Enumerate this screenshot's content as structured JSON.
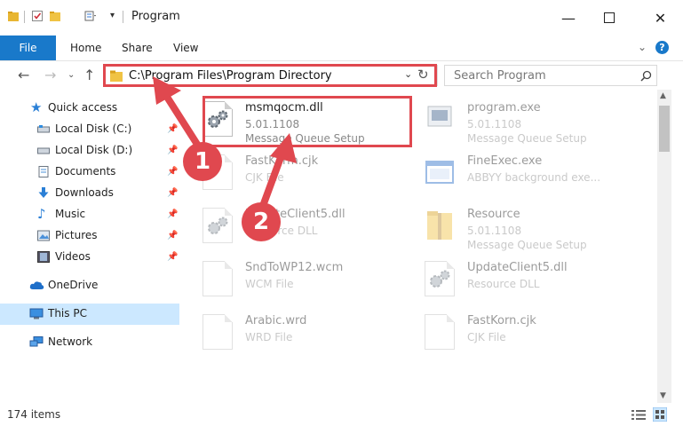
{
  "window": {
    "title": "Program"
  },
  "ribbon": {
    "tabs": [
      "File",
      "Home",
      "Share",
      "View"
    ]
  },
  "address": {
    "path": "C:\\Program Files\\Program Directory"
  },
  "search": {
    "placeholder": "Search Program"
  },
  "nav": {
    "quick_access": "Quick access",
    "items": [
      {
        "label": "Local Disk (C:)",
        "icon": "drive-icon"
      },
      {
        "label": "Local Disk (D:)",
        "icon": "drive-icon"
      },
      {
        "label": "Documents",
        "icon": "documents-icon"
      },
      {
        "label": "Downloads",
        "icon": "downloads-icon"
      },
      {
        "label": "Music",
        "icon": "music-icon"
      },
      {
        "label": "Pictures",
        "icon": "pictures-icon"
      },
      {
        "label": "Videos",
        "icon": "videos-icon"
      }
    ],
    "onedrive": "OneDrive",
    "this_pc": "This PC",
    "network": "Network"
  },
  "files": [
    {
      "name": "msmqocm.dll",
      "line2": "5.01.1108",
      "line3": "Message Queue Setup",
      "icon": "dll-gear-icon"
    },
    {
      "name": "program.exe",
      "line2": "5.01.1108",
      "line3": "Message Queue Setup",
      "icon": "exe-icon"
    },
    {
      "name": "FastKorm.cjk",
      "line2": "CJK File",
      "line3": "",
      "icon": "file-icon"
    },
    {
      "name": "FineExec.exe",
      "line2": "ABBYY background exe...",
      "line3": "",
      "icon": "window-exe-icon"
    },
    {
      "name": "UpdateClient5.dll",
      "line2": "Resource DLL",
      "line3": "",
      "icon": "dll-gear-icon"
    },
    {
      "name": "Resource",
      "line2": "5.01.1108",
      "line3": "Message Queue Setup",
      "icon": "folder-zip-icon"
    },
    {
      "name": "SndToWP12.wcm",
      "line2": "WCM File",
      "line3": "",
      "icon": "file-icon"
    },
    {
      "name": "UpdateClient5.dll",
      "line2": "Resource DLL",
      "line3": "",
      "icon": "dll-gear-icon"
    },
    {
      "name": "Arabic.wrd",
      "line2": "WRD File",
      "line3": "",
      "icon": "file-icon"
    },
    {
      "name": "FastKorn.cjk",
      "line2": "CJK File",
      "line3": "",
      "icon": "file-icon"
    }
  ],
  "status": {
    "items_count": "174 items"
  },
  "annotations": {
    "step1": "1",
    "step2": "2"
  },
  "colors": {
    "accent": "#1979ca",
    "highlight": "#e0484f",
    "selected": "#cce8ff"
  }
}
